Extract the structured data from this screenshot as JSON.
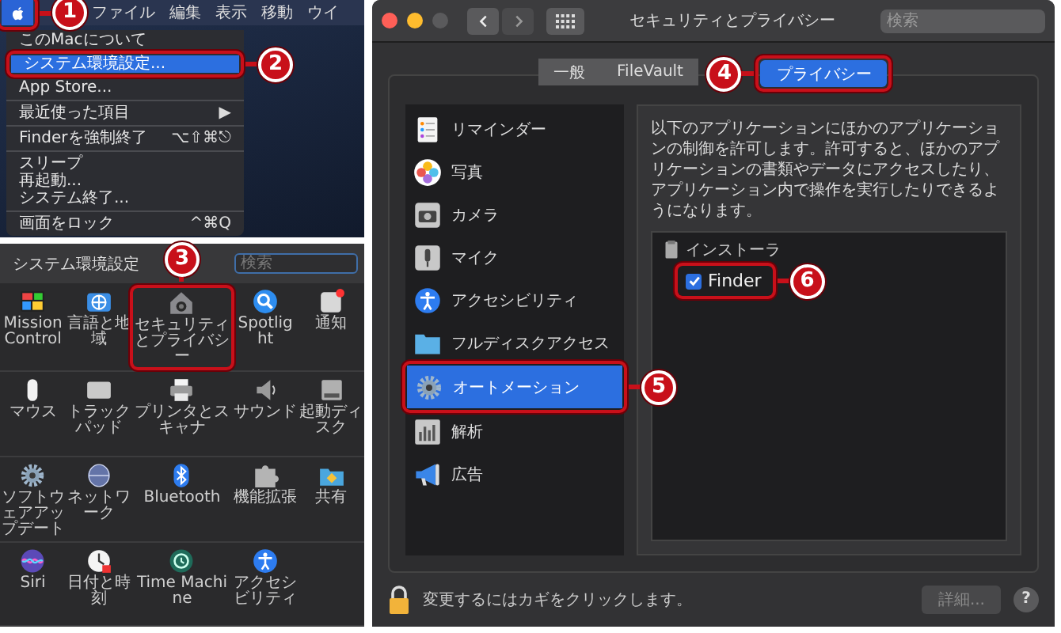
{
  "menu_panel": {
    "apple": {
      "callout": "1"
    },
    "titles": [
      "ファイル",
      "編集",
      "表示",
      "移動",
      "ウイ"
    ],
    "menu_groups": [
      [
        {
          "label": "このMacについて",
          "selected": false
        },
        {
          "label": "システム環境設定...",
          "selected": true,
          "callout": "2"
        },
        {
          "label": "App Store...",
          "selected": false
        }
      ],
      [
        {
          "label": "最近使った項目",
          "shortcut": "▶",
          "selected": false
        }
      ],
      [
        {
          "label": "Finderを強制終了",
          "shortcut": "⌥⇧⌘⎋",
          "selected": false
        }
      ],
      [
        {
          "label": "スリープ",
          "selected": false
        },
        {
          "label": "再起動...",
          "selected": false
        },
        {
          "label": "システム終了...",
          "selected": false
        }
      ],
      [
        {
          "label": "画面をロック",
          "shortcut": "^⌘Q",
          "selected": false
        }
      ]
    ]
  },
  "prefs_panel": {
    "title": "システム環境設定",
    "search": {
      "placeholder": "検索"
    },
    "rows": [
      [
        {
          "label": "Mission Control",
          "kind": "mission"
        },
        {
          "label": "言語と地域",
          "kind": "globe"
        },
        {
          "label": "セキュリティとプライバシー",
          "kind": "house",
          "callout": "3"
        },
        {
          "label": "Spotlight",
          "kind": "spotlight"
        },
        {
          "label": "通知",
          "kind": "notify"
        }
      ],
      [
        {
          "label": "マウス",
          "kind": "mouse"
        },
        {
          "label": "トラックパッド",
          "kind": "trackpad"
        },
        {
          "label": "プリンタとスキャナ",
          "kind": "printer"
        },
        {
          "label": "サウンド",
          "kind": "speaker"
        },
        {
          "label": "起動ディスク",
          "kind": "disk"
        }
      ],
      [
        {
          "label": "ソフトウェアアップデート",
          "kind": "gear"
        },
        {
          "label": "ネットワーク",
          "kind": "sphere"
        },
        {
          "label": "Bluetooth",
          "kind": "bluetooth"
        },
        {
          "label": "機能拡張",
          "kind": "puzzle"
        },
        {
          "label": "共有",
          "kind": "share"
        }
      ],
      [
        {
          "label": "Siri",
          "kind": "siri"
        },
        {
          "label": "日付と時刻",
          "kind": "clock"
        },
        {
          "label": "Time Machine",
          "kind": "timemachine"
        },
        {
          "label": "アクセシビリティ",
          "kind": "access"
        }
      ]
    ]
  },
  "window": {
    "title": "セキュリティとプライバシー",
    "search": {
      "placeholder": "検索"
    },
    "tabs": [
      {
        "label": "一般",
        "selected": false
      },
      {
        "label": "FileVault",
        "selected": false
      },
      {
        "label": "プライバシー",
        "selected": true,
        "callout": "4"
      }
    ],
    "categories": [
      {
        "label": "リマインダー",
        "kind": "reminders",
        "selected": false
      },
      {
        "label": "写真",
        "kind": "photos",
        "selected": false
      },
      {
        "label": "カメラ",
        "kind": "camera",
        "selected": false
      },
      {
        "label": "マイク",
        "kind": "mic",
        "selected": false
      },
      {
        "label": "アクセシビリティ",
        "kind": "access",
        "selected": false
      },
      {
        "label": "フルディスクアクセス",
        "kind": "folder",
        "selected": false
      },
      {
        "label": "オートメーション",
        "kind": "gear",
        "selected": true,
        "callout": "5"
      },
      {
        "label": "解析",
        "kind": "chart",
        "selected": false
      },
      {
        "label": "広告",
        "kind": "megaphone",
        "selected": false
      }
    ],
    "description": "以下のアプリケーションにほかのアプリケーションの制御を許可します。許可すると、ほかのアプリケーションの書類やデータにアクセスしたり、アプリケーション内で操作を実行したりできるようになります。",
    "apps": [
      {
        "label": "インストーラ",
        "children": [
          {
            "label": "Finder",
            "checked": true,
            "callout": "6"
          }
        ]
      }
    ],
    "footer": {
      "lock_text": "変更するにはカギをクリックします。",
      "details_button": {
        "label": "詳細...",
        "disabled": true
      },
      "help_button": "?"
    }
  }
}
